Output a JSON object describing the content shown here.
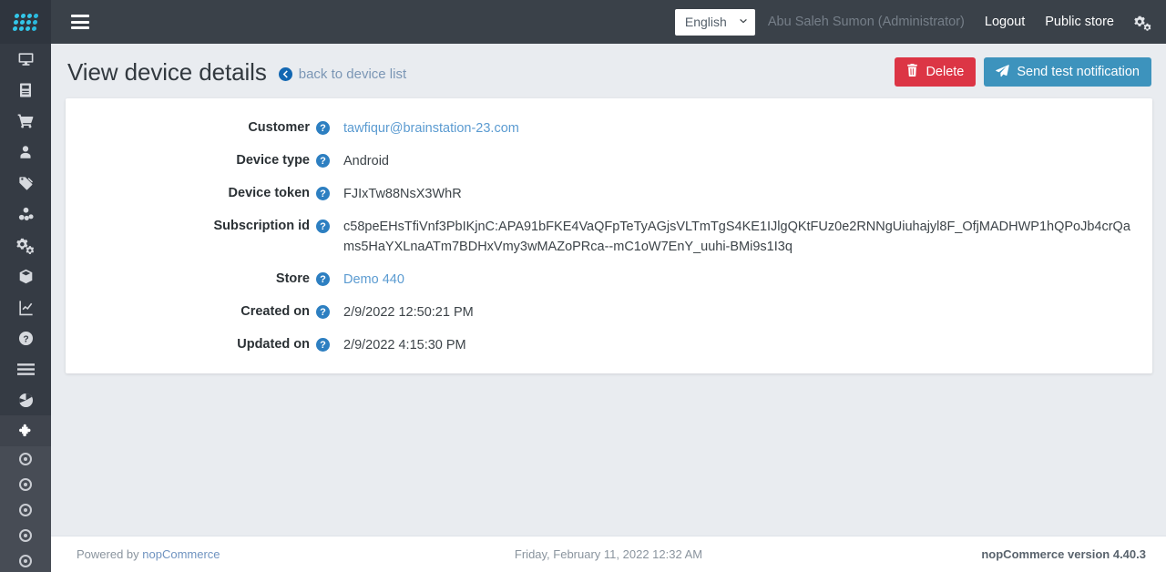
{
  "brand": {
    "logo": "nopcommerce-dots-logo",
    "accent": "#33c6e8"
  },
  "topbar": {
    "menu_toggle": "hamburger-icon",
    "language": {
      "selected": "English",
      "options": [
        "English"
      ]
    },
    "user": "Abu Saleh Sumon (Administrator)",
    "logout": "Logout",
    "public_store": "Public store",
    "settings_icon": "gears-icon"
  },
  "sidebar": {
    "items": [
      {
        "name": "dashboard",
        "icon": "desktop-icon"
      },
      {
        "name": "catalog",
        "icon": "book-icon"
      },
      {
        "name": "sales",
        "icon": "shopping-cart-icon"
      },
      {
        "name": "customers",
        "icon": "user-icon"
      },
      {
        "name": "promotions",
        "icon": "tag-icon"
      },
      {
        "name": "content-management",
        "icon": "cubes-icon"
      },
      {
        "name": "configuration",
        "icon": "gears-icon"
      },
      {
        "name": "system",
        "icon": "cube-icon"
      },
      {
        "name": "reports",
        "icon": "chart-line-icon"
      },
      {
        "name": "help",
        "icon": "question-circle-icon"
      },
      {
        "name": "third-party-plugins",
        "icon": "bars-icon"
      },
      {
        "name": "analytics",
        "icon": "pie-chart-icon"
      }
    ],
    "active": {
      "name": "plugins",
      "icon": "puzzle-piece-icon"
    },
    "sub_items": [
      {
        "name": "plugin-item-1",
        "icon": "dot-circle-icon"
      },
      {
        "name": "plugin-item-2",
        "icon": "dot-circle-icon"
      },
      {
        "name": "plugin-item-3",
        "icon": "dot-circle-icon"
      },
      {
        "name": "plugin-item-4",
        "icon": "dot-circle-icon"
      },
      {
        "name": "plugin-item-5",
        "icon": "dot-circle-icon"
      }
    ]
  },
  "page": {
    "title": "View device details",
    "back_link": "back to device list",
    "delete_button": "Delete",
    "send_test_button": "Send test notification",
    "colors": {
      "danger": "#dc3545",
      "info": "#3d93bd",
      "link": "#5b9bd1"
    }
  },
  "details": {
    "help_glyph": "?",
    "rows": [
      {
        "label": "Customer",
        "value": "tawfiqur@brainstation-23.com",
        "is_link": true
      },
      {
        "label": "Device type",
        "value": "Android",
        "is_link": false
      },
      {
        "label": "Device token",
        "value": "FJIxTw88NsX3WhR",
        "is_link": false
      },
      {
        "label": "Subscription id",
        "value": "c58peEHsTfiVnf3PbIKjnC:APA91bFKE4VaQFpTeTyAGjsVLTmTgS4KE1IJlgQKtFUz0e2RNNgUiuhajyl8F_OfjMADHWP1hQPoJb4crQams5HaYXLnaATm7BDHxVmy3wMAZoPRca--mC1oW7EnY_uuhi-BMi9s1I3q",
        "is_link": false
      },
      {
        "label": "Store",
        "value": "Demo 440",
        "is_link": true
      },
      {
        "label": "Created on",
        "value": "2/9/2022 12:50:21 PM",
        "is_link": false
      },
      {
        "label": "Updated on",
        "value": "2/9/2022 4:15:30 PM",
        "is_link": false
      }
    ]
  },
  "footer": {
    "powered_by_prefix": "Powered by",
    "powered_by_link": "nopCommerce",
    "date": "Friday, February 11, 2022 12:32 AM",
    "version": "nopCommerce version 4.40.3"
  }
}
